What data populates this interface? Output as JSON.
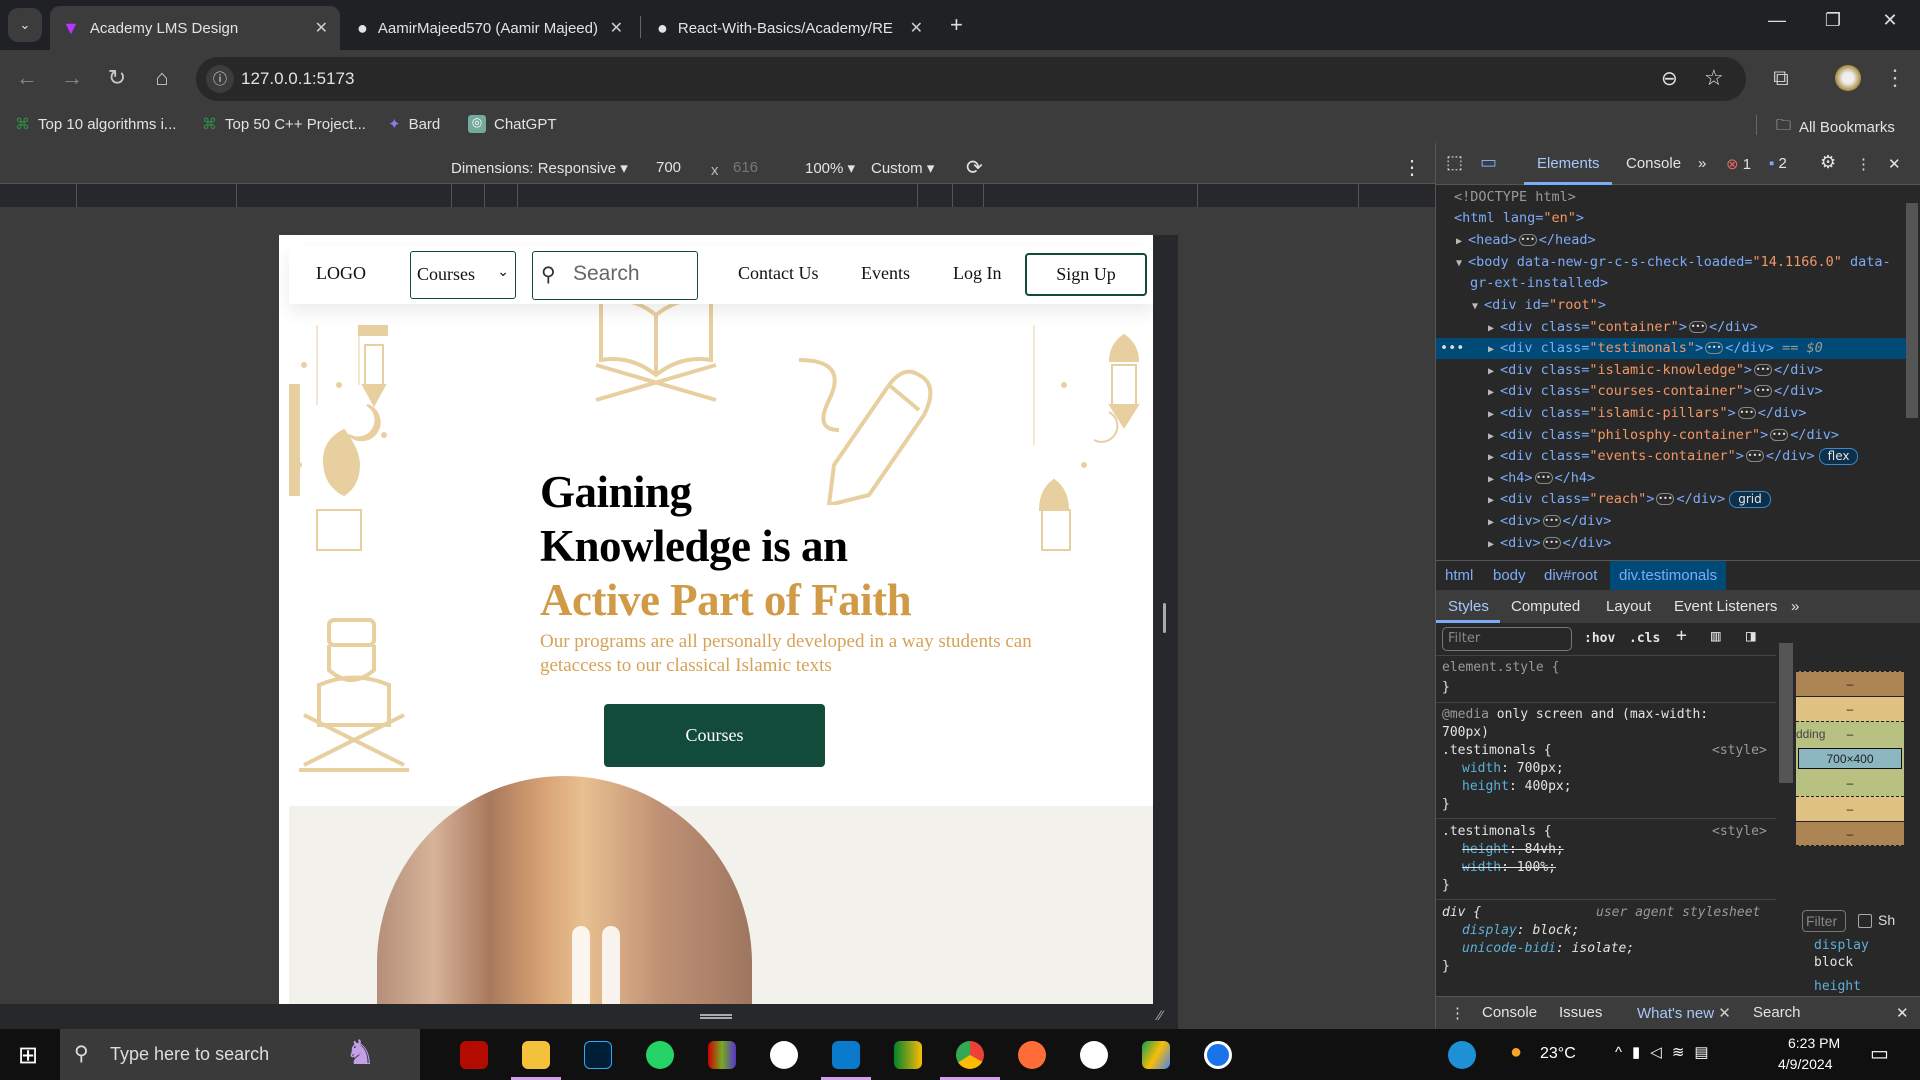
{
  "browser": {
    "tabs": [
      {
        "title": "Academy LMS Design",
        "icon": "vite-icon"
      },
      {
        "title": "AamirMajeed570 (Aamir Majeed)",
        "icon": "github-icon"
      },
      {
        "title": "React-With-Basics/Academy/RE",
        "icon": "github-icon"
      }
    ],
    "url": "127.0.0.1:5173",
    "bookmarks": [
      {
        "label": "Top 10 algorithms i...",
        "icon": "gfg-icon"
      },
      {
        "label": "Top 50 C++ Project...",
        "icon": "gfg-icon"
      },
      {
        "label": "Bard",
        "icon": "bard-icon"
      },
      {
        "label": "ChatGPT",
        "icon": "chatgpt-icon"
      }
    ],
    "all_bookmarks": "All Bookmarks"
  },
  "device_toolbar": {
    "dimensions": "Dimensions: Responsive",
    "width": "700",
    "x": "x",
    "height": "616",
    "zoom": "100%",
    "throttle": "Custom"
  },
  "page": {
    "nav": {
      "logo": "LOGO",
      "courses_select": "Courses",
      "search_placeholder": "Search",
      "contact": "Contact Us",
      "events": "Events",
      "login": "Log In",
      "signup": "Sign Up"
    },
    "hero": {
      "line1": "Gaining",
      "line2": "Knowledge is an",
      "line3": "Active Part of Faith",
      "subtitle": "Our programs are all personally developed in a way students can getaccess to our classical Islamic texts",
      "button": "Courses"
    },
    "colors": {
      "primary": "#134b3a",
      "gold": "#d19a47",
      "beige": "#f2f1ec"
    }
  },
  "devtools": {
    "tabs": {
      "elements": "Elements",
      "console": "Console",
      "errors": "1",
      "messages": "2"
    },
    "tree": {
      "doctype": "<!DOCTYPE html>",
      "html_open": "<html lang=",
      "html_lang": "\"en\"",
      "head": "<head>",
      "head_close": "</head>",
      "body_open": "<body data-new-gr-c-s-check-loaded=",
      "body_val": "\"14.1166.0\"",
      "body_rest": " data-",
      "body_cont": "gr-ext-installed>",
      "root_open": "<div id=",
      "root_val": "\"root\"",
      "div_class": "<div class=",
      "div_close": "</div>",
      "classes": [
        "\"container\"",
        "\"testimonals\"",
        "\"islamic-knowledge\"",
        "\"courses-container\"",
        "\"islamic-pillars\"",
        "\"philosphy-container\"",
        "\"events-container\"",
        "\"reach\""
      ],
      "selected_marker": "== $0",
      "h4": "<h4>",
      "h4_close": "</h4>",
      "div_plain": "<div>",
      "flex_badge": "flex",
      "grid_badge": "grid"
    },
    "breadcrumbs": [
      "html",
      "body",
      "div#root",
      "div.testimonals"
    ],
    "subtabs": [
      "Styles",
      "Computed",
      "Layout",
      "Event Listeners"
    ],
    "filter_placeholder": "Filter",
    "hov": ":hov",
    "cls": ".cls",
    "styles": {
      "element_style": "element.style {",
      "close": "}",
      "media": "@media",
      "media_rest": " only screen and (max-width:",
      "media_cont": "700px)",
      "rule1_selector": ".testimonals {",
      "source": "<style>",
      "rule1_props": [
        [
          "width",
          ": 700px;"
        ],
        [
          "height",
          ": 400px;"
        ]
      ],
      "rule2_selector": ".testimonals {",
      "rule2_props": [
        [
          "height",
          ": 84vh;"
        ],
        [
          "width",
          ": 100%;"
        ]
      ],
      "ua_selector": "div {",
      "ua_source": "user agent stylesheet",
      "ua_props": [
        [
          "display",
          ": block;"
        ],
        [
          "unicode-bidi",
          ": isolate;"
        ]
      ]
    },
    "box_model": {
      "size": "700×400",
      "dash": "–",
      "padding_label": "dding"
    },
    "computed": {
      "filter": "Filter",
      "show": "Sh",
      "prop1": "display",
      "val1": "block",
      "prop2": "height"
    },
    "drawer": [
      "Console",
      "Issues",
      "What's new",
      "Search"
    ]
  },
  "taskbar": {
    "search": "Type here to search",
    "weather": "23°C",
    "time": "6:23 PM",
    "date": "4/9/2024"
  }
}
